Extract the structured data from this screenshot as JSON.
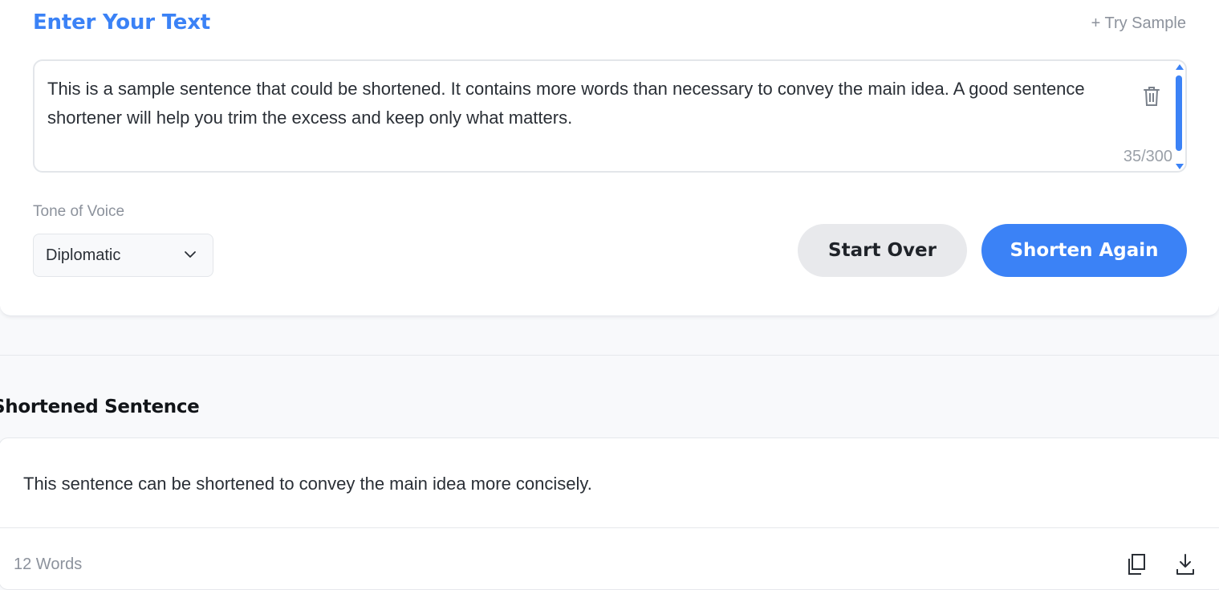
{
  "input_section": {
    "title": "Enter Your Text",
    "try_sample_label": "+ Try Sample",
    "text": "This is a sample sentence that could be shortened. It contains more words than necessary to convey the main idea. A good sentence shortener will help you trim the excess and keep only what matters.",
    "char_count": "35/300",
    "delete_icon": "trash-icon"
  },
  "tone": {
    "label": "Tone of Voice",
    "selected": "Diplomatic",
    "chevron_icon": "chevron-down-icon"
  },
  "actions": {
    "start_over_label": "Start Over",
    "shorten_again_label": "Shorten Again"
  },
  "result": {
    "title": "Shortened Sentence",
    "text": "This sentence can be shortened to convey the main idea more concisely.",
    "word_count": "12 Words",
    "copy_icon": "copy-icon",
    "download_icon": "download-icon"
  },
  "colors": {
    "accent": "#3b82f6",
    "secondary_button": "#e8e9ec",
    "muted_text": "#8c929c"
  }
}
